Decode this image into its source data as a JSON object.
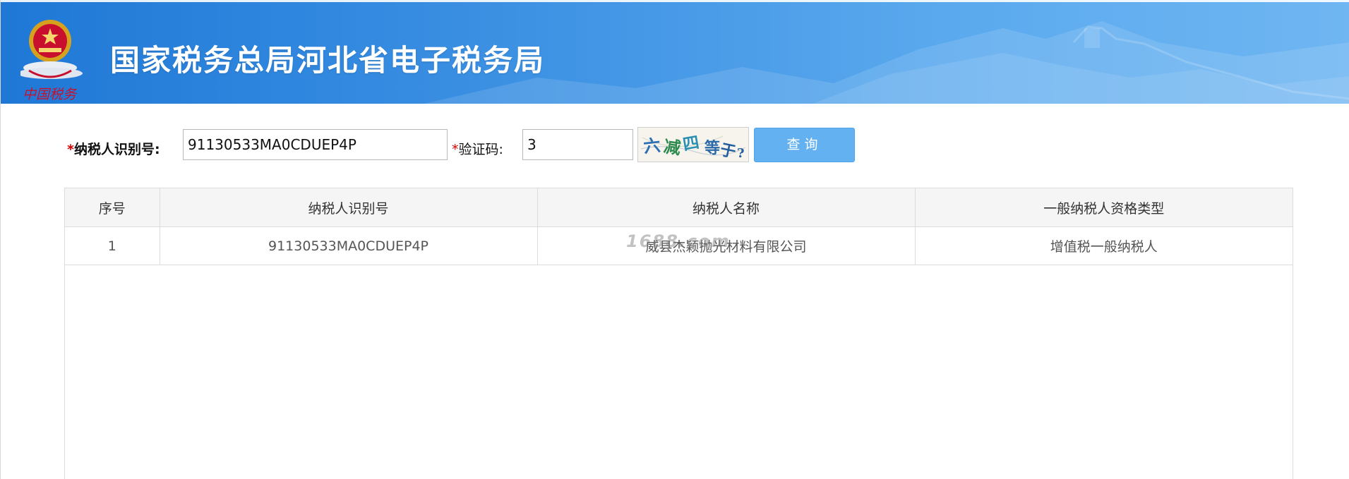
{
  "header": {
    "title": "国家税务总局河北省电子税务局",
    "emblem_caption": "中国税务"
  },
  "form": {
    "taxpayer_id_label": "纳税人识别号:",
    "taxpayer_id_value": "91130533MA0CDUEP4P",
    "captcha_label": "验证码:",
    "captcha_value": "3",
    "captcha_image_text": "六减四等于?",
    "query_button_label": "查询"
  },
  "table": {
    "columns": [
      "序号",
      "纳税人识别号",
      "纳税人名称",
      "一般纳税人资格类型"
    ],
    "rows": [
      {
        "index": "1",
        "taxpayer_id": "91130533MA0CDUEP4P",
        "taxpayer_name": "威县杰颖抛光材料有限公司",
        "qualification_type": "增值税一般纳税人"
      }
    ]
  },
  "watermark": "1688.com",
  "colors": {
    "banner_start": "#1f78d6",
    "banner_end": "#6fb6f2",
    "required_marker": "#d40000",
    "query_button": "#63b1f1"
  }
}
